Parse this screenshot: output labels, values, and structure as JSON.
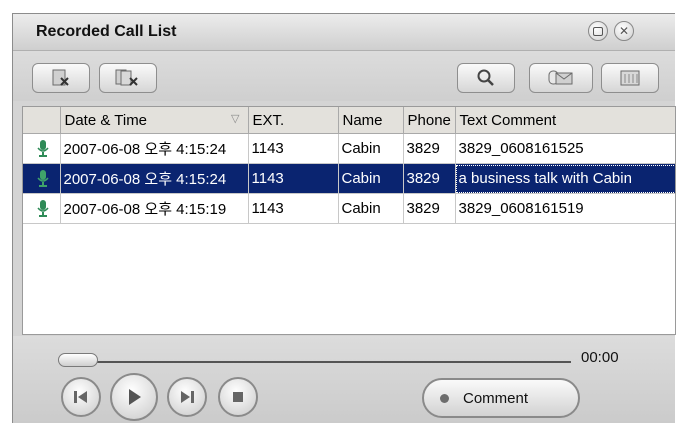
{
  "window": {
    "title": "Recorded Call List",
    "controls": [
      "restore-icon",
      "close-icon"
    ]
  },
  "toolbar": {
    "left_buttons": [
      "delete-record-icon",
      "delete-all-records-icon"
    ],
    "right_buttons": [
      "search-icon",
      "send-mail-icon",
      "list-view-icon"
    ]
  },
  "list": {
    "columns": [
      "",
      "Date & Time",
      "EXT.",
      "Name",
      "Phone",
      "Text Comment"
    ],
    "rows": [
      {
        "date_time": "2007-06-08 오후 4:15:24",
        "ext": "1143",
        "name": "Cabin",
        "phone": "3829",
        "comment": "3829_0608161525",
        "selected": false
      },
      {
        "date_time": "2007-06-08 오후 4:15:24",
        "ext": "1143",
        "name": "Cabin",
        "phone": "3829",
        "comment": "a business talk with Cabin",
        "selected": true
      },
      {
        "date_time": "2007-06-08 오후 4:15:19",
        "ext": "1143",
        "name": "Cabin",
        "phone": "3829",
        "comment": "3829_0608161519",
        "selected": false
      }
    ]
  },
  "player": {
    "time": "00:00",
    "progress": 0,
    "comment_label": "Comment",
    "buttons": [
      "previous-icon",
      "play-icon",
      "next-icon",
      "stop-icon"
    ]
  },
  "colors": {
    "selection": "#0a2470",
    "chrome": "#d4d4d4"
  }
}
